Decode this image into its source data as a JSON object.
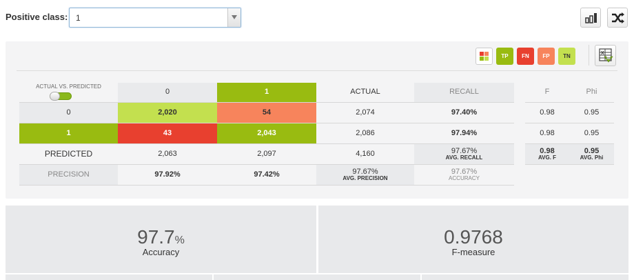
{
  "toolbar": {
    "positive_class_label": "Positive class:",
    "positive_class_value": "1",
    "chart_icon": "bar-chart-icon",
    "shuffle_icon": "shuffle-icon"
  },
  "legend": {
    "grid_icon": "color-grid-icon",
    "tp": "TP",
    "fn": "FN",
    "fp": "FP",
    "tn": "TN",
    "export_icon": "export-excel-icon",
    "colors": {
      "tp": "#99bb11",
      "fn": "#e8402f",
      "fp": "#f7845c",
      "tn": "#c3e04f"
    }
  },
  "matrix": {
    "corner_label": "ACTUAL VS. PREDICTED",
    "col_headers": [
      "0",
      "1"
    ],
    "actual_label": "ACTUAL",
    "recall_label": "RECALL",
    "f_label": "F",
    "phi_label": "Phi",
    "rows": [
      {
        "label": "0",
        "cells": [
          "2,020",
          "54"
        ],
        "actual": "2,074",
        "recall": "97.40%",
        "f": "0.98",
        "phi": "0.95"
      },
      {
        "label": "1",
        "cells": [
          "43",
          "2,043"
        ],
        "actual": "2,086",
        "recall": "97.94%",
        "f": "0.98",
        "phi": "0.95"
      }
    ],
    "predicted": {
      "label": "PREDICTED",
      "values": [
        "2,063",
        "2,097"
      ],
      "total": "4,160",
      "avg_recall": "97.67%",
      "avg_recall_label": "AVG. RECALL",
      "avg_f": "0.98",
      "avg_f_label": "AVG. F",
      "avg_phi": "0.95",
      "avg_phi_label": "AVG. Phi"
    },
    "precision": {
      "label": "PRECISION",
      "values": [
        "97.92%",
        "97.42%"
      ],
      "avg_precision": "97.67%",
      "avg_precision_label": "AVG. PRECISION",
      "accuracy": "97.67%",
      "accuracy_label": "ACCURACY"
    }
  },
  "metrics": {
    "accuracy_value": "97.7",
    "accuracy_unit": "%",
    "accuracy_label": "Accuracy",
    "fmeasure_value": "0.9768",
    "fmeasure_label": "F-measure"
  }
}
